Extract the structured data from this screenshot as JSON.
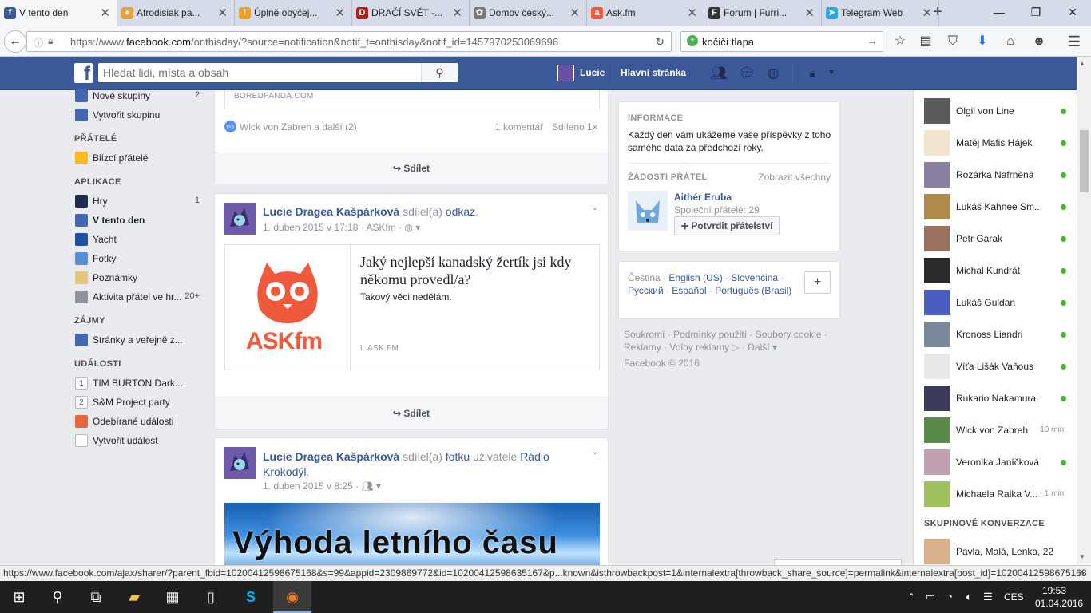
{
  "browser": {
    "tabs": [
      {
        "label": "V tento den",
        "fav": "f",
        "favcolor": "#3b5998",
        "active": true
      },
      {
        "label": "Afrodisiak pa...",
        "fav": "●",
        "favcolor": "#e6a23c"
      },
      {
        "label": "Úplně obyčej...",
        "fav": "!",
        "favcolor": "#f0a020"
      },
      {
        "label": "DRAČÍ SVĚT -...",
        "fav": "D",
        "favcolor": "#b71c1c"
      },
      {
        "label": "Domov český...",
        "fav": "✿",
        "favcolor": "#777777"
      },
      {
        "label": "Ask.fm",
        "fav": "a",
        "favcolor": "#ef5a3c"
      },
      {
        "label": "Forum | Furri...",
        "fav": "F",
        "favcolor": "#333333"
      },
      {
        "label": "Telegram Web",
        "fav": "➤",
        "favcolor": "#2ca5e0"
      }
    ],
    "url_prefix": "https://www.",
    "url_domain": "facebook.com",
    "url_rest": "/onthisday/?source=notification&notif_t=onthisday&notif_id=1457970253069696",
    "search_value": "kočičí tlapa",
    "status_url": "https://www.facebook.com/ajax/sharer/?parent_fbid=10200412598675168&s=99&appid=2309869772&id=10200412598635167&p...known&isthrowbackpost=1&internalextra[throwback_share_source]=permalink&internalextra[post_id]=10200412598675168"
  },
  "fb_header": {
    "search_placeholder": "Hledat lidi, místa a obsah",
    "user_name": "Lucie",
    "home_label": "Hlavní stránka"
  },
  "left_nav": {
    "items_top": [
      {
        "label": "Nové skupiny",
        "count": "2",
        "icon_color": "#4267b2"
      },
      {
        "label": "Vytvořit skupinu",
        "count": "",
        "icon_color": "#4267b2"
      }
    ],
    "friends_heading": "PŘÁTELÉ",
    "friends_items": [
      {
        "label": "Blízcí přátelé",
        "count": "",
        "icon_color": "#f7b928"
      }
    ],
    "apps_heading": "APLIKACE",
    "apps_items": [
      {
        "label": "Hry",
        "count": "1",
        "icon_color": "#1c2b4f"
      },
      {
        "label": "V tento den",
        "count": "",
        "icon_color": "#4267b2",
        "bold": true
      },
      {
        "label": "Yacht",
        "count": "",
        "icon_color": "#1d4fa3"
      },
      {
        "label": "Fotky",
        "count": "",
        "icon_color": "#5a8fd6"
      },
      {
        "label": "Poznámky",
        "count": "",
        "icon_color": "#e4c77a"
      },
      {
        "label": "Aktivita přátel ve hr...",
        "count": "20+",
        "icon_color": "#90949c"
      }
    ],
    "interests_heading": "ZÁJMY",
    "interests_items": [
      {
        "label": "Stránky a veřejně z...",
        "count": "",
        "icon_color": "#4267b2"
      }
    ],
    "events_heading": "UDÁLOSTI",
    "events_items": [
      {
        "label": "TIM BURTON Dark...",
        "count": "",
        "icon_color": "#ffffff",
        "day": "1"
      },
      {
        "label": "S&M Project party",
        "count": "",
        "icon_color": "#ffffff",
        "day": "2"
      },
      {
        "label": "Odebírané události",
        "count": "",
        "icon_color": "#e9663b"
      },
      {
        "label": "Vytvořit událost",
        "count": "",
        "icon_color": "#ffffff"
      }
    ]
  },
  "feed": {
    "post0": {
      "source": "BOREDPANDA.COM",
      "likes_text": "Wlck von Zabreh a další (2)",
      "comments_text": "1 komentář",
      "shares_text": "Sdíleno 1×",
      "share_label": "Sdílet"
    },
    "post1": {
      "author": "Lucie Dragea Kašpárková",
      "action": "sdílel(a)",
      "object": "odkaz",
      "date": "1. duben 2015 v 17:18",
      "via": "ASKfm",
      "link_title": "Jaký nejlepší kanadský žertík jsi kdy někomu provedl/a?",
      "link_desc": "Takový věci nedělám.",
      "link_domain": "L.ASK.FM",
      "logo_text": "ASKfm",
      "share_label": "Sdílet"
    },
    "post2": {
      "author": "Lucie Dragea Kašpárková",
      "action": "sdílel(a)",
      "object": "fotku",
      "owner_prefix": "uživatele",
      "owner": "Rádio Krokodýl",
      "date": "1. duben 2015 v 8:25",
      "photo_text": "Výhoda letního času"
    }
  },
  "right_col": {
    "info_heading": "INFORMACE",
    "info_text": "Každý den vám ukážeme vaše příspěvky z toho samého data za předchozí roky.",
    "requests_heading": "ŽÁDOSTI PŘÁTEL",
    "see_all": "Zobrazit všechny",
    "request_name": "Aithér Eruba",
    "mutual": "Společní přátelé: 29",
    "confirm_label": "Potvrdit přátelství",
    "languages": [
      "Čeština",
      "English (US)",
      "Slovenčina",
      "Русский",
      "Español",
      "Português (Brasil)"
    ],
    "footer_links": [
      "Soukromí",
      "Podmínky použití",
      "Soubory cookie",
      "Reklamy",
      "Volby reklamy",
      "Další"
    ],
    "copyright": "Facebook © 2016"
  },
  "chat": {
    "contacts": [
      {
        "name": "Olgii von Line",
        "status": "online",
        "color": "#5a5a5a"
      },
      {
        "name": "Matěj Mafis Hájek",
        "status": "online",
        "color": "#f2e6d0"
      },
      {
        "name": "Rozárka Nafrněná",
        "status": "online",
        "color": "#8a7fa0"
      },
      {
        "name": "Lukáš Kahnee Sm...",
        "status": "online",
        "color": "#b08a4a"
      },
      {
        "name": "Petr Garak",
        "status": "online",
        "color": "#9a7060"
      },
      {
        "name": "Michal Kundrát",
        "status": "online",
        "color": "#2a2a2a"
      },
      {
        "name": "Lukáš Guldan",
        "status": "online",
        "color": "#4a5cc0"
      },
      {
        "name": "Kronoss Liandri",
        "status": "online",
        "color": "#7a8a9a"
      },
      {
        "name": "Víťa Lišák Vaňous",
        "status": "online",
        "color": "#e8e8e8"
      },
      {
        "name": "Rukario Nakamura",
        "status": "online",
        "color": "#3a3a5a"
      },
      {
        "name": "Wlck von Zabreh",
        "status": "10 min.",
        "color": "#5a8a4a"
      },
      {
        "name": "Veronika Janíčková",
        "status": "online",
        "color": "#c0a0b0"
      },
      {
        "name": "Michaela Raika V...",
        "status": "1 min.",
        "color": "#a0c060"
      }
    ],
    "group_heading": "SKUPINOVÉ KONVERZACE",
    "group_name": "Pavla, Malá, Lenka, 22"
  },
  "taskbar": {
    "lang": "CES",
    "time": "19:53",
    "date": "01.04.2016"
  }
}
